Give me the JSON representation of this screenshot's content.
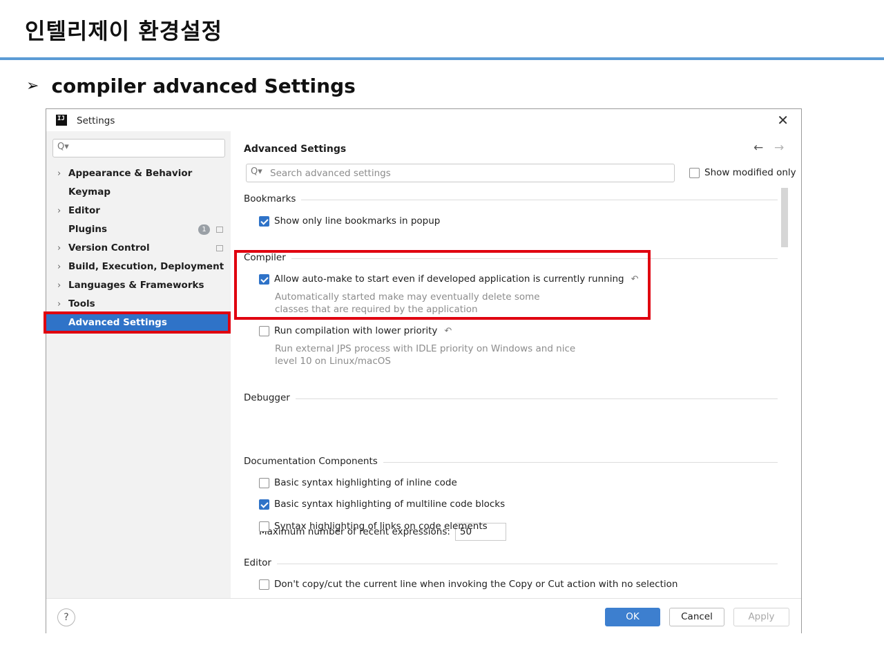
{
  "slide": {
    "title": "인텔리제이 환경설정",
    "bullet": "➢",
    "subtitle": "compiler advanced Settings"
  },
  "dialog": {
    "title": "Settings",
    "app_icon": "IJ",
    "close_icon": "✕",
    "sidebar": {
      "search_icon": "Q▾",
      "items": [
        {
          "label": "Appearance & Behavior",
          "chevron": "›"
        },
        {
          "label": "Keymap"
        },
        {
          "label": "Editor",
          "chevron": "›"
        },
        {
          "label": "Plugins",
          "badge": "1"
        },
        {
          "label": "Version Control",
          "chevron": "›"
        },
        {
          "label": "Build, Execution, Deployment",
          "chevron": "›"
        },
        {
          "label": "Languages & Frameworks",
          "chevron": "›"
        },
        {
          "label": "Tools",
          "chevron": "›"
        },
        {
          "label": "Advanced Settings",
          "selected": true
        }
      ]
    },
    "content": {
      "heading": "Advanced Settings",
      "back_icon": "←",
      "forward_icon": "→",
      "search_icon": "Q▾",
      "search_placeholder": "Search advanced settings",
      "show_modified_only": "Show modified only",
      "reset_icon": "↶",
      "bookmarks": {
        "label": "Bookmarks",
        "show_only_line": "Show only line bookmarks in popup"
      },
      "compiler": {
        "label": "Compiler",
        "auto_make": "Allow auto-make to start even if developed application is currently running",
        "auto_make_hint": "Automatically started make may eventually delete some classes that are required by the application",
        "lower_priority": "Run compilation with lower priority",
        "lower_priority_hint": "Run external JPS process with IDLE priority on Windows and nice level 10 on Linux/macOS"
      },
      "debugger": {
        "label": "Debugger",
        "recent_expr_label": "Maximum number of recent expressions:",
        "recent_expr_value": "50"
      },
      "documentation": {
        "label": "Documentation Components",
        "inline_code": "Basic syntax highlighting of inline code",
        "multiline_code": "Basic syntax highlighting of multiline code blocks",
        "links": "Syntax highlighting of links on code elements"
      },
      "editor": {
        "label": "Editor",
        "partial_option": "Don't copy/cut the current line when invoking the Copy or Cut action with no selection"
      }
    },
    "footer": {
      "help": "?",
      "ok": "OK",
      "cancel": "Cancel",
      "apply": "Apply"
    }
  },
  "colors": {
    "accent": "#2f73c8",
    "highlight": "#e0000f",
    "title_rule": "#5b9bd5"
  }
}
